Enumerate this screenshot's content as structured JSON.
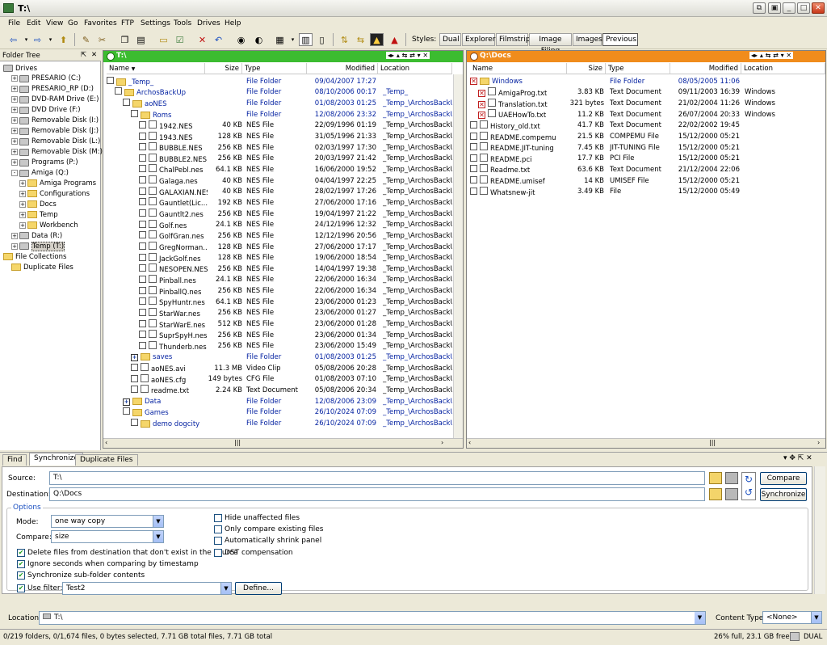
{
  "window": {
    "title": "T:\\"
  },
  "menu": [
    "File",
    "Edit",
    "View",
    "Go",
    "Favorites",
    "FTP",
    "Settings",
    "Tools",
    "Drives",
    "Help"
  ],
  "styles": {
    "label": "Styles:",
    "items": [
      "Dual",
      "Explorer",
      "Filmstrip",
      "Image Filing",
      "Images",
      "Previous"
    ],
    "active": "Previous"
  },
  "folder_tree": {
    "title": "Folder Tree",
    "items": [
      {
        "label": "Drives",
        "level": 0,
        "kind": "drive"
      },
      {
        "label": "PRESARIO (C:)",
        "level": 1,
        "kind": "drive",
        "pm": "+"
      },
      {
        "label": "PRESARIO_RP (D:)",
        "level": 1,
        "kind": "drive",
        "pm": "+"
      },
      {
        "label": "DVD-RAM Drive (E:)",
        "level": 1,
        "kind": "drive",
        "pm": "+"
      },
      {
        "label": "DVD Drive (F:)",
        "level": 1,
        "kind": "drive",
        "pm": "+"
      },
      {
        "label": "Removable Disk (I:)",
        "level": 1,
        "kind": "drive",
        "pm": "+"
      },
      {
        "label": "Removable Disk (J:)",
        "level": 1,
        "kind": "drive",
        "pm": "+"
      },
      {
        "label": "Removable Disk (L:)",
        "level": 1,
        "kind": "drive",
        "pm": "+"
      },
      {
        "label": "Removable Disk (M:)",
        "level": 1,
        "kind": "drive",
        "pm": "+"
      },
      {
        "label": "Programs (P:)",
        "level": 1,
        "kind": "drive",
        "pm": "+"
      },
      {
        "label": "Amiga (Q:)",
        "level": 1,
        "kind": "drive",
        "pm": "-"
      },
      {
        "label": "Amiga Programs",
        "level": 2,
        "kind": "folder",
        "pm": "+"
      },
      {
        "label": "Configurations",
        "level": 2,
        "kind": "folder",
        "pm": "+"
      },
      {
        "label": "Docs",
        "level": 2,
        "kind": "folder",
        "pm": "+"
      },
      {
        "label": "Temp",
        "level": 2,
        "kind": "folder",
        "pm": "+"
      },
      {
        "label": "Workbench",
        "level": 2,
        "kind": "folder",
        "pm": "+"
      },
      {
        "label": "Data (R:)",
        "level": 1,
        "kind": "drive",
        "pm": "+"
      },
      {
        "label": "Temp (T:)",
        "level": 1,
        "kind": "drive",
        "pm": "+",
        "selected": true
      },
      {
        "label": "File Collections",
        "level": 0,
        "kind": "folder"
      },
      {
        "label": "Duplicate Files",
        "level": 1,
        "kind": "folder"
      }
    ]
  },
  "left_pane": {
    "path": "T:\\",
    "columns": [
      "Name",
      "Size",
      "Type",
      "Modified",
      "Location"
    ],
    "rows": [
      {
        "name": "_Temp_",
        "size": "",
        "type": "File Folder",
        "modified": "09/04/2007 17:27",
        "location": "",
        "indent": 0,
        "folder": true
      },
      {
        "name": "ArchosBackUp",
        "size": "",
        "type": "File Folder",
        "modified": "08/10/2006 00:17",
        "location": "_Temp_",
        "indent": 1,
        "folder": true
      },
      {
        "name": "aoNES",
        "size": "",
        "type": "File Folder",
        "modified": "01/08/2003 01:25",
        "location": "_Temp_\\ArchosBackUp",
        "indent": 2,
        "folder": true
      },
      {
        "name": "Roms",
        "size": "",
        "type": "File Folder",
        "modified": "12/08/2006 23:32",
        "location": "_Temp_\\ArchosBackUp",
        "indent": 3,
        "folder": true
      },
      {
        "name": "1942.NES",
        "size": "40 KB",
        "type": "NES File",
        "modified": "22/09/1996 01:19",
        "location": "_Temp_\\ArchosBackUp",
        "indent": 4
      },
      {
        "name": "1943.NES",
        "size": "128 KB",
        "type": "NES File",
        "modified": "31/05/1996 21:33",
        "location": "_Temp_\\ArchosBackUp",
        "indent": 4
      },
      {
        "name": "BUBBLE.NES",
        "size": "256 KB",
        "type": "NES File",
        "modified": "02/03/1997 17:30",
        "location": "_Temp_\\ArchosBackUp",
        "indent": 4
      },
      {
        "name": "BUBBLE2.NES",
        "size": "256 KB",
        "type": "NES File",
        "modified": "20/03/1997 21:42",
        "location": "_Temp_\\ArchosBackUp",
        "indent": 4
      },
      {
        "name": "ChalPebl.nes",
        "size": "64.1 KB",
        "type": "NES File",
        "modified": "16/06/2000 19:52",
        "location": "_Temp_\\ArchosBackUp",
        "indent": 4
      },
      {
        "name": "Galaga.nes",
        "size": "40 KB",
        "type": "NES File",
        "modified": "04/04/1997 22:25",
        "location": "_Temp_\\ArchosBackUp",
        "indent": 4
      },
      {
        "name": "GALAXIAN.NES",
        "size": "40 KB",
        "type": "NES File",
        "modified": "28/02/1997 17:26",
        "location": "_Temp_\\ArchosBackUp",
        "indent": 4
      },
      {
        "name": "Gauntlet(Lic...",
        "size": "192 KB",
        "type": "NES File",
        "modified": "27/06/2000 17:16",
        "location": "_Temp_\\ArchosBackUp",
        "indent": 4
      },
      {
        "name": "Gauntlt2.nes",
        "size": "256 KB",
        "type": "NES File",
        "modified": "19/04/1997 21:22",
        "location": "_Temp_\\ArchosBackUp",
        "indent": 4
      },
      {
        "name": "Golf.nes",
        "size": "24.1 KB",
        "type": "NES File",
        "modified": "24/12/1996 12:32",
        "location": "_Temp_\\ArchosBackUp",
        "indent": 4
      },
      {
        "name": "GolfGran.nes",
        "size": "256 KB",
        "type": "NES File",
        "modified": "12/12/1996 20:56",
        "location": "_Temp_\\ArchosBackUp",
        "indent": 4
      },
      {
        "name": "GregNorman....",
        "size": "128 KB",
        "type": "NES File",
        "modified": "27/06/2000 17:17",
        "location": "_Temp_\\ArchosBackUp",
        "indent": 4
      },
      {
        "name": "JackGolf.nes",
        "size": "128 KB",
        "type": "NES File",
        "modified": "19/06/2000 18:54",
        "location": "_Temp_\\ArchosBackUp",
        "indent": 4
      },
      {
        "name": "NESOPEN.NES",
        "size": "256 KB",
        "type": "NES File",
        "modified": "14/04/1997 19:38",
        "location": "_Temp_\\ArchosBackUp",
        "indent": 4
      },
      {
        "name": "Pinball.nes",
        "size": "24.1 KB",
        "type": "NES File",
        "modified": "22/06/2000 16:34",
        "location": "_Temp_\\ArchosBackUp",
        "indent": 4
      },
      {
        "name": "PinballQ.nes",
        "size": "256 KB",
        "type": "NES File",
        "modified": "22/06/2000 16:34",
        "location": "_Temp_\\ArchosBackUp",
        "indent": 4
      },
      {
        "name": "SpyHuntr.nes",
        "size": "64.1 KB",
        "type": "NES File",
        "modified": "23/06/2000 01:23",
        "location": "_Temp_\\ArchosBackUp",
        "indent": 4
      },
      {
        "name": "StarWar.nes",
        "size": "256 KB",
        "type": "NES File",
        "modified": "23/06/2000 01:27",
        "location": "_Temp_\\ArchosBackUp",
        "indent": 4
      },
      {
        "name": "StarWarE.nes",
        "size": "512 KB",
        "type": "NES File",
        "modified": "23/06/2000 01:28",
        "location": "_Temp_\\ArchosBackUp",
        "indent": 4
      },
      {
        "name": "SuprSpyH.nes",
        "size": "256 KB",
        "type": "NES File",
        "modified": "23/06/2000 01:34",
        "location": "_Temp_\\ArchosBackUp",
        "indent": 4
      },
      {
        "name": "Thunderb.nes",
        "size": "256 KB",
        "type": "NES File",
        "modified": "23/06/2000 15:49",
        "location": "_Temp_\\ArchosBackUp",
        "indent": 4
      },
      {
        "name": "saves",
        "size": "",
        "type": "File Folder",
        "modified": "01/08/2003 01:25",
        "location": "_Temp_\\ArchosBackUp",
        "indent": 3,
        "folder": true,
        "plus": true
      },
      {
        "name": "aoNES.avi",
        "size": "11.3 MB",
        "type": "Video Clip",
        "modified": "05/08/2006 20:28",
        "location": "_Temp_\\ArchosBackUp",
        "indent": 3
      },
      {
        "name": "aoNES.cfg",
        "size": "149 bytes",
        "type": "CFG File",
        "modified": "01/08/2003 07:10",
        "location": "_Temp_\\ArchosBackUp",
        "indent": 3
      },
      {
        "name": "readme.txt",
        "size": "2.24 KB",
        "type": "Text Document",
        "modified": "05/08/2006 20:34",
        "location": "_Temp_\\ArchosBackUp",
        "indent": 3
      },
      {
        "name": "Data",
        "size": "",
        "type": "File Folder",
        "modified": "12/08/2006 23:09",
        "location": "_Temp_\\ArchosBackUp",
        "indent": 2,
        "folder": true,
        "plus": true
      },
      {
        "name": "Games",
        "size": "",
        "type": "File Folder",
        "modified": "26/10/2024 07:09",
        "location": "_Temp_\\ArchosBackUp",
        "indent": 2,
        "folder": true
      },
      {
        "name": "demo dogcity",
        "size": "",
        "type": "File Folder",
        "modified": "26/10/2024 07:09",
        "location": "_Temp_\\ArchosBackUp",
        "indent": 3,
        "folder": true
      }
    ]
  },
  "right_pane": {
    "path": "Q:\\Docs",
    "columns": [
      "Name",
      "Size",
      "Type",
      "Modified",
      "Location"
    ],
    "rows": [
      {
        "name": "Windows",
        "size": "",
        "type": "File Folder",
        "modified": "08/05/2005 11:06",
        "location": "",
        "folder": true,
        "x": true
      },
      {
        "name": "AmigaProg.txt",
        "size": "3.83 KB",
        "type": "Text Document",
        "modified": "09/11/2003 16:39",
        "location": "Windows",
        "x": true,
        "indent": 1
      },
      {
        "name": "Translation.txt",
        "size": "321 bytes",
        "type": "Text Document",
        "modified": "21/02/2004 11:26",
        "location": "Windows",
        "x": true,
        "indent": 1
      },
      {
        "name": "UAEHowTo.txt",
        "size": "11.2 KB",
        "type": "Text Document",
        "modified": "26/07/2004 20:33",
        "location": "Windows",
        "x": true,
        "indent": 1
      },
      {
        "name": "History_old.txt",
        "size": "41.7 KB",
        "type": "Text Document",
        "modified": "22/02/2002 19:45",
        "location": ""
      },
      {
        "name": "README.compemu",
        "size": "21.5 KB",
        "type": "COMPEMU File",
        "modified": "15/12/2000 05:21",
        "location": ""
      },
      {
        "name": "README.JIT-tuning",
        "size": "7.45 KB",
        "type": "JIT-TUNING File",
        "modified": "15/12/2000 05:21",
        "location": ""
      },
      {
        "name": "README.pci",
        "size": "17.7 KB",
        "type": "PCI File",
        "modified": "15/12/2000 05:21",
        "location": ""
      },
      {
        "name": "Readme.txt",
        "size": "63.6 KB",
        "type": "Text Document",
        "modified": "21/12/2004 22:06",
        "location": ""
      },
      {
        "name": "README.umisef",
        "size": "14 KB",
        "type": "UMISEF File",
        "modified": "15/12/2000 05:21",
        "location": ""
      },
      {
        "name": "Whatsnew-jit",
        "size": "3.49 KB",
        "type": "File",
        "modified": "15/12/2000 05:49",
        "location": ""
      }
    ]
  },
  "bottom": {
    "tabs": [
      "Find",
      "Synchronize",
      "Duplicate Files"
    ],
    "active_tab": "Synchronize",
    "source_label": "Source:",
    "source_value": "T:\\",
    "dest_label": "Destination:",
    "dest_value": "Q:\\Docs",
    "compare_button": "Compare",
    "sync_button": "Synchronize",
    "options_label": "Options",
    "mode_label": "Mode:",
    "mode_value": "one way copy",
    "compare_label": "Compare:",
    "compare_value": "size",
    "checks": [
      {
        "label": "Delete files from destination that don't exist in the source",
        "checked": true
      },
      {
        "label": "Ignore seconds when comparing by timestamp",
        "checked": true
      },
      {
        "label": "Synchronize sub-folder contents",
        "checked": true
      },
      {
        "label": "Use filter:",
        "checked": true
      }
    ],
    "filter_value": "Test2",
    "define_button": "Define...",
    "right_checks": [
      {
        "label": "Hide unaffected files",
        "checked": false
      },
      {
        "label": "Only compare existing files",
        "checked": false
      },
      {
        "label": "Automatically shrink panel",
        "checked": false
      },
      {
        "label": "DST compensation",
        "checked": false
      }
    ]
  },
  "location_bar": {
    "label": "Location",
    "value": "T:\\",
    "content_type_label": "Content Type",
    "content_type_value": "<None>"
  },
  "status": {
    "left": "0/219 folders, 0/1,674 files, 0 bytes selected, 7.71 GB total files, 7.71 GB total",
    "right": "26% full, 23.1 GB free",
    "mode": "DUAL"
  }
}
